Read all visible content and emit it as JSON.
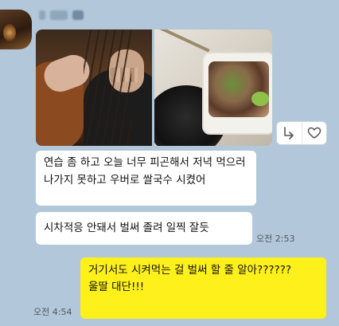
{
  "chat": {
    "sender_name": "( ░ ░ ░",
    "photo_message": {
      "photo_1": "cello-practice-photo",
      "photo_2": "pho-takeout-photo",
      "actions": {
        "share": "share-icon",
        "like": "heart-icon"
      }
    },
    "messages": [
      {
        "side": "left",
        "text": "연습 좀 하고 오늘 너무 피곤해서 저녁 먹으러 나가지 못하고 우버로 쌀국수 시켰어"
      },
      {
        "side": "left",
        "text": "시차적응 안돼서 벌써 졸려 일찍 잘듯",
        "time": "오전 2:53"
      },
      {
        "side": "right",
        "text": "거기서도 시켜먹는 걸 벌써 할 줄 알아?????? \n울딸 대단!!!",
        "time": "오전 4:54"
      }
    ]
  },
  "colors": {
    "background": "#b2c7d9",
    "my_bubble": "#fef01b",
    "their_bubble": "#ffffff"
  }
}
